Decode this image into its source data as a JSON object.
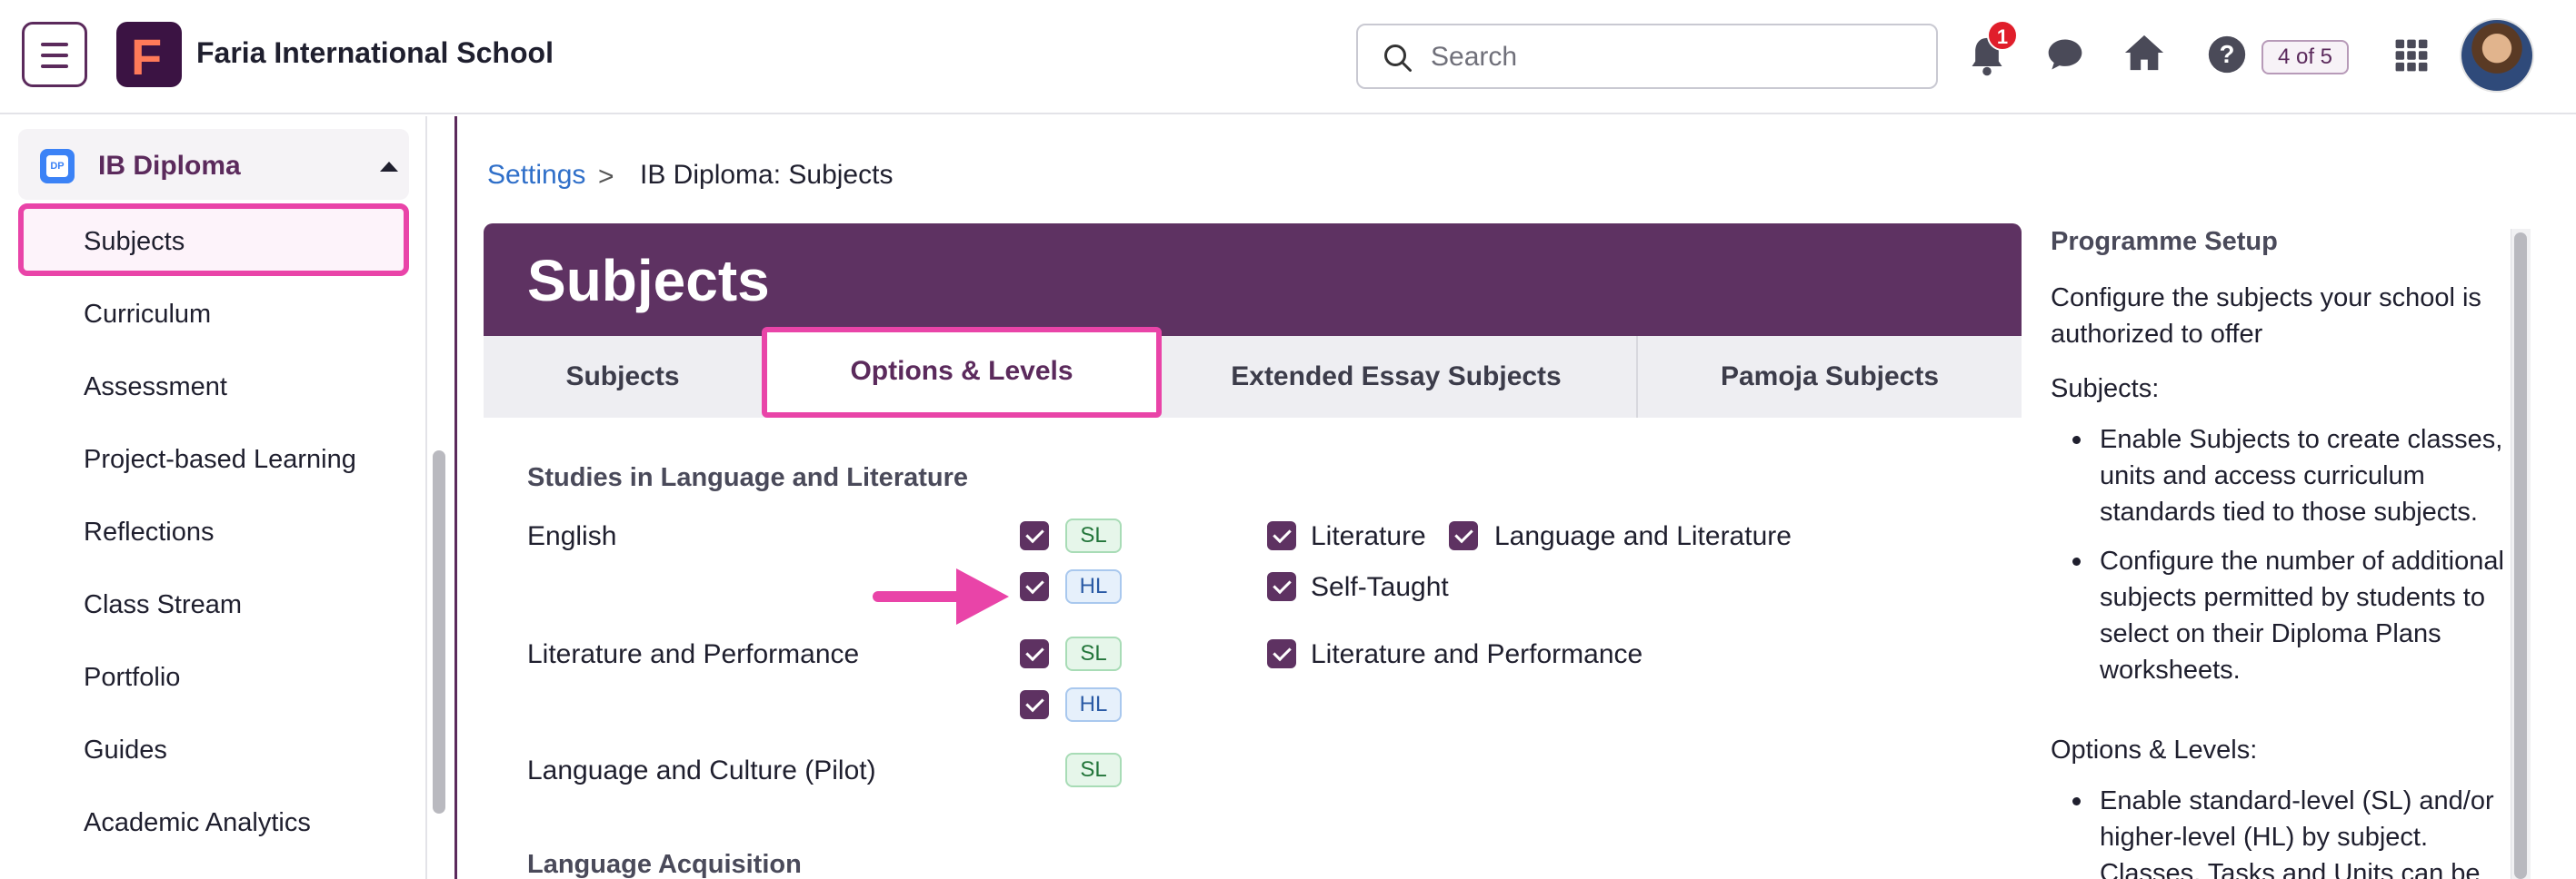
{
  "header": {
    "school_name": "Faria International School",
    "logo_letter": "F",
    "search_placeholder": "Search",
    "notification_count": "1",
    "progress_counter": "4 of 5"
  },
  "sidebar": {
    "programme": "IB Diploma",
    "programme_icon_text": "DP",
    "items": [
      {
        "label": "Subjects",
        "active": true
      },
      {
        "label": "Curriculum"
      },
      {
        "label": "Assessment"
      },
      {
        "label": "Project-based Learning"
      },
      {
        "label": "Reflections"
      },
      {
        "label": "Class Stream"
      },
      {
        "label": "Portfolio"
      },
      {
        "label": "Guides"
      },
      {
        "label": "Academic Analytics"
      }
    ]
  },
  "breadcrumb": {
    "link": "Settings",
    "separator": ">",
    "current": "IB Diploma: Subjects"
  },
  "page": {
    "title": "Subjects",
    "tabs": [
      {
        "label": "Subjects"
      },
      {
        "label": "Options & Levels",
        "active": true
      },
      {
        "label": "Extended Essay Subjects"
      },
      {
        "label": "Pamoja Subjects"
      }
    ]
  },
  "content": {
    "group1_title": "Studies in Language and Literature",
    "group2_title": "Language Acquisition",
    "rows": [
      {
        "subject": "English",
        "sl": "SL",
        "hl": "HL",
        "options": [
          "Literature",
          "Language and Literature",
          "Self-Taught"
        ]
      },
      {
        "subject": "Literature and Performance",
        "sl": "SL",
        "hl": "HL",
        "options": [
          "Literature and Performance"
        ]
      },
      {
        "subject": "Language and Culture (Pilot)",
        "sl": "SL"
      }
    ]
  },
  "help_panel": {
    "title": "Programme Setup",
    "intro": "Configure the subjects your school is authorized to offer",
    "subjects_heading": "Subjects:",
    "subjects_bullets": [
      "Enable Subjects to create classes, units and access curriculum standards tied to those subjects.",
      "Configure the number of additional subjects permitted by students to select on their Diploma Plans worksheets."
    ],
    "options_heading": "Options & Levels:",
    "options_bullets": [
      "Enable standard-level (SL) and/or higher-level (HL) by subject. Classes, Tasks and Units can be"
    ]
  },
  "colors": {
    "brand_purple": "#5e3262",
    "highlight_pink": "#e944a8",
    "link_blue": "#2f6fc9"
  }
}
